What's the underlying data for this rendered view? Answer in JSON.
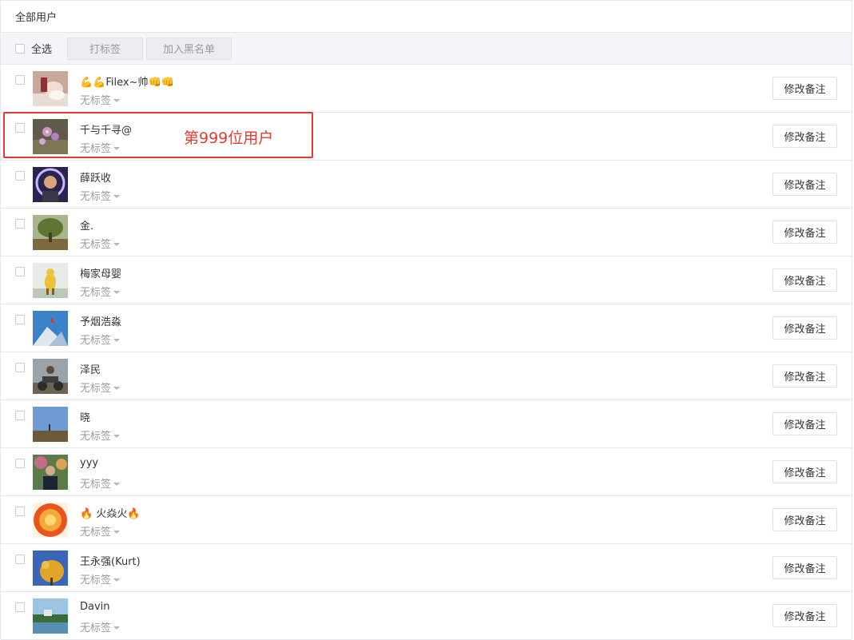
{
  "header": {
    "title": "全部用户"
  },
  "toolbar": {
    "select_all_label": "全选",
    "tag_button": "打标签",
    "blacklist_button": "加入黑名单"
  },
  "annotation": {
    "text": "第999位用户",
    "color": "#e33b32"
  },
  "users": [
    {
      "name": "💪💪Filex~帅👊👊",
      "tag": "无标签",
      "remark_button": "修改备注",
      "avatar": "hand-photo"
    },
    {
      "name": "千与千寻@",
      "tag": "无标签",
      "remark_button": "修改备注",
      "avatar": "flower-photo"
    },
    {
      "name": "薛跃收",
      "tag": "无标签",
      "remark_button": "修改备注",
      "avatar": "portrait-light-photo"
    },
    {
      "name": "金.",
      "tag": "无标签",
      "remark_button": "修改备注",
      "avatar": "tree-landscape-photo"
    },
    {
      "name": "梅家母婴",
      "tag": "无标签",
      "remark_button": "修改备注",
      "avatar": "yellow-toy-photo"
    },
    {
      "name": "予烟浩淼",
      "tag": "无标签",
      "remark_button": "修改备注",
      "avatar": "sky-photo"
    },
    {
      "name": "泽民",
      "tag": "无标签",
      "remark_button": "修改备注",
      "avatar": "motorbike-photo"
    },
    {
      "name": "晓",
      "tag": "无标签",
      "remark_button": "修改备注",
      "avatar": "field-sky-photo"
    },
    {
      "name": "yyy",
      "tag": "无标签",
      "remark_button": "修改备注",
      "avatar": "man-garden-photo"
    },
    {
      "name": "🔥 火焱火🔥",
      "tag": "无标签",
      "remark_button": "修改备注",
      "avatar": "sun-photo"
    },
    {
      "name": "王永强(Kurt)",
      "tag": "无标签",
      "remark_button": "修改备注",
      "avatar": "autumn-tree-photo"
    },
    {
      "name": "Davin",
      "tag": "无标签",
      "remark_button": "修改备注",
      "avatar": "lake-photo"
    }
  ]
}
